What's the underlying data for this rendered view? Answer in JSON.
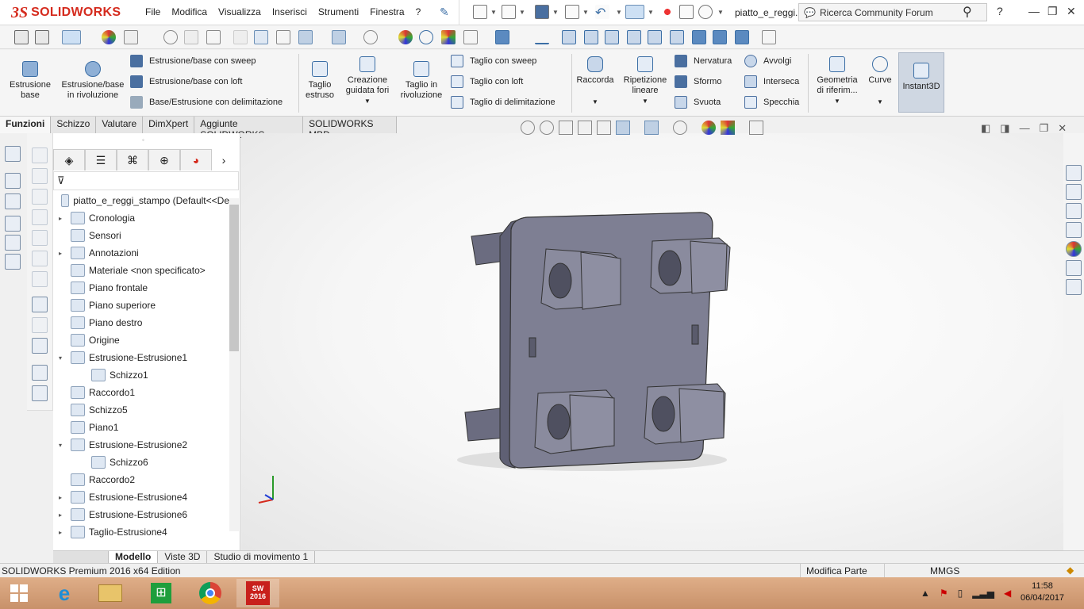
{
  "app": {
    "logo_ds": "3S",
    "logo_text": "SOLIDWORKS",
    "doc_title": "piatto_e_reggi...",
    "search_placeholder": "Ricerca Community Forum",
    "help": "?"
  },
  "menu": [
    "File",
    "Modifica",
    "Visualizza",
    "Inserisci",
    "Strumenti",
    "Finestra",
    "?"
  ],
  "ribbon": {
    "estrusione_base": "Estrusione\nbase",
    "estrusione_rivoluzione": "Estrusione/base\nin rivoluzione",
    "list1": [
      "Estrusione/base con sweep",
      "Estrusione/base con loft",
      "Base/Estrusione con delimitazione"
    ],
    "taglio_estruso": "Taglio\nestruso",
    "creazione_fori": "Creazione\nguidata fori",
    "taglio_rivoluzione": "Taglio in\nrivoluzione",
    "list2": [
      "Taglio con sweep",
      "Taglio con loft",
      "Taglio di delimitazione"
    ],
    "raccorda": "Raccorda",
    "ripetizione": "Ripetizione\nlineare",
    "list3": [
      "Nervatura",
      "Sformo",
      "Svuota"
    ],
    "list4": [
      "Avvolgi",
      "Interseca",
      "Specchia"
    ],
    "geometria": "Geometria\ndi riferim...",
    "curve": "Curve",
    "instant3d": "Instant3D"
  },
  "tabs": [
    "Funzioni",
    "Schizzo",
    "Valutare",
    "DimXpert",
    "Aggiunte SOLIDWORKS",
    "SOLIDWORKS MBD"
  ],
  "tree": {
    "root": "piatto_e_reggi_stampo  (Default<<De",
    "items": [
      {
        "label": "Cronologia",
        "expand": "▸",
        "indent": 0
      },
      {
        "label": "Sensori",
        "expand": "",
        "indent": 0
      },
      {
        "label": "Annotazioni",
        "expand": "▸",
        "indent": 0
      },
      {
        "label": "Materiale <non specificato>",
        "expand": "",
        "indent": 0
      },
      {
        "label": "Piano frontale",
        "expand": "",
        "indent": 0
      },
      {
        "label": "Piano superiore",
        "expand": "",
        "indent": 0
      },
      {
        "label": "Piano destro",
        "expand": "",
        "indent": 0
      },
      {
        "label": "Origine",
        "expand": "",
        "indent": 0
      },
      {
        "label": "Estrusione-Estrusione1",
        "expand": "▾",
        "indent": 0
      },
      {
        "label": "Schizzo1",
        "expand": "",
        "indent": 1
      },
      {
        "label": "Raccordo1",
        "expand": "",
        "indent": 0
      },
      {
        "label": "Schizzo5",
        "expand": "",
        "indent": 0
      },
      {
        "label": "Piano1",
        "expand": "",
        "indent": 0
      },
      {
        "label": "Estrusione-Estrusione2",
        "expand": "▾",
        "indent": 0
      },
      {
        "label": "Schizzo6",
        "expand": "",
        "indent": 1
      },
      {
        "label": "Raccordo2",
        "expand": "",
        "indent": 0
      },
      {
        "label": "Estrusione-Estrusione4",
        "expand": "▸",
        "indent": 0
      },
      {
        "label": "Estrusione-Estrusione6",
        "expand": "▸",
        "indent": 0
      },
      {
        "label": "Taglio-Estrusione4",
        "expand": "▸",
        "indent": 0
      }
    ]
  },
  "bottom_tabs": [
    "Modello",
    "Viste 3D",
    "Studio di movimento 1"
  ],
  "status": {
    "edition": "SOLIDWORKS Premium 2016 x64 Edition",
    "mode": "Modifica Parte",
    "units": "MMGS"
  },
  "taskbar": {
    "time": "11:58",
    "date": "06/04/2017",
    "sw_label": "2016"
  },
  "colors": {
    "brand": "#d52b1e",
    "part": "#7e7f93",
    "accent": "#3b6ea5"
  }
}
